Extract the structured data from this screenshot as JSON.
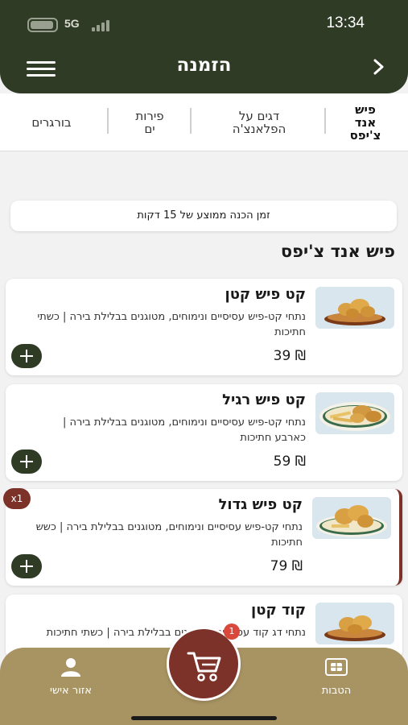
{
  "status": {
    "time": "13:34",
    "network": "5G"
  },
  "header": {
    "title": "הזמנה"
  },
  "categories": [
    {
      "label": "פיש\nאנד\nצ'יפס",
      "active": true
    },
    {
      "label": "דגים על\nהפלאנצ'ה",
      "active": false
    },
    {
      "label": "פירות\nים",
      "active": false
    },
    {
      "label": "בורגרים",
      "active": false
    }
  ],
  "prep_time": "זמן הכנה ממוצע של 15 דקות",
  "section_title": "פיש אנד צ'יפס",
  "products": [
    {
      "name": "קט פיש קטן",
      "desc": "נתחי קט-פיש עסיסיים ונימוחים, מטוגנים בבלילת בירה | כשתי חתיכות",
      "price": "39 ₪"
    },
    {
      "name": "קט פיש רגיל",
      "desc": "נתחי קט-פיש עסיסיים ונימוחים, מטוגנים בבלילת בירה | כארבע חתיכות",
      "price": "59 ₪"
    },
    {
      "name": "קט פיש גדול",
      "desc": "נתחי קט-פיש עסיסיים ונימוחים, מטוגנים בבלילת בירה | כשש חתיכות",
      "price": "79 ₪",
      "quantity_badge": "x1"
    },
    {
      "name": "קוד קטן",
      "desc": "נתחי דג קוד עסיסיים, מטוגנים בבלילת בירה | כשתי חתיכות"
    }
  ],
  "cart": {
    "count": "1"
  },
  "bottom_nav": {
    "benefits_label": "הטבות",
    "personal_label": "אזור אישי"
  },
  "colors": {
    "header": "#2f3b25",
    "accent": "#7c3229",
    "bottom_bar": "#a89463"
  }
}
